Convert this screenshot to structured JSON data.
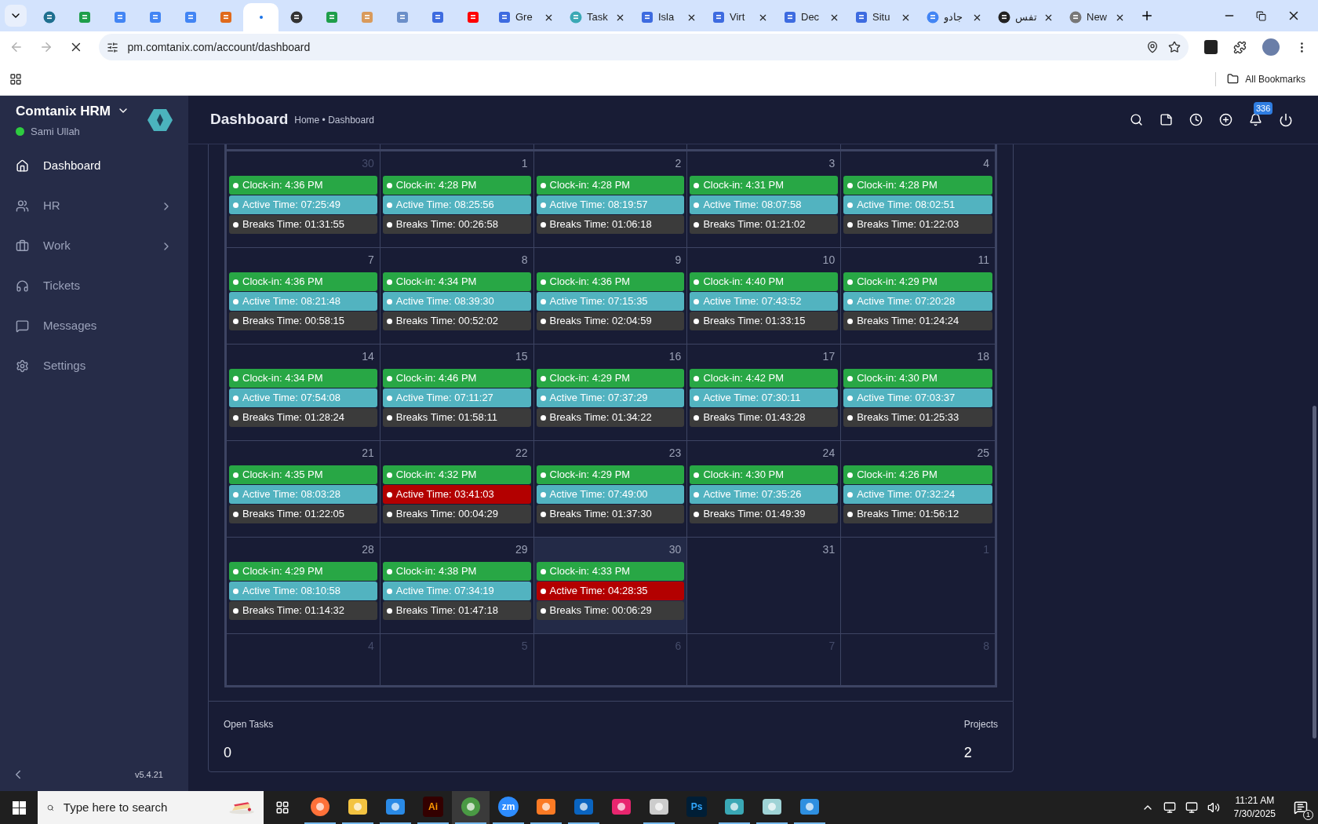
{
  "browser": {
    "tabs": [
      {
        "selected": false
      },
      {
        "selected": false
      },
      {
        "selected": false
      },
      {
        "selected": false
      },
      {
        "selected": false
      },
      {
        "selected": false
      },
      {
        "selected": true
      },
      {
        "selected": false
      },
      {
        "selected": false
      },
      {
        "selected": false
      },
      {
        "selected": false
      },
      {
        "selected": false
      },
      {
        "selected": false
      },
      {
        "title": "Gre",
        "selected": false
      },
      {
        "title": "Task",
        "selected": false
      },
      {
        "title": "Isla",
        "selected": false
      },
      {
        "title": "Virt",
        "selected": false
      },
      {
        "title": "Dec",
        "selected": false
      },
      {
        "title": "Situ",
        "selected": false
      },
      {
        "title": "جادو",
        "selected": false
      },
      {
        "title": "تفس",
        "selected": false
      },
      {
        "title": "New",
        "selected": false
      }
    ],
    "address": "pm.comtanix.com/account/dashboard",
    "bookmarks_label": "All Bookmarks"
  },
  "sidebar": {
    "brand": "Comtanix HRM",
    "user": "Sami Ullah",
    "online": true,
    "items": [
      {
        "label": "Dashboard",
        "selected": true,
        "has_submenu": false
      },
      {
        "label": "HR",
        "selected": false,
        "has_submenu": true
      },
      {
        "label": "Work",
        "selected": false,
        "has_submenu": true
      },
      {
        "label": "Tickets",
        "selected": false,
        "has_submenu": false
      },
      {
        "label": "Messages",
        "selected": false,
        "has_submenu": false
      },
      {
        "label": "Settings",
        "selected": false,
        "has_submenu": false
      }
    ],
    "version": "v5.4.21"
  },
  "header": {
    "title": "Dashboard",
    "breadcrumb": "Home • Dashboard",
    "notification_count": "336"
  },
  "calendar": {
    "weeks": [
      [
        {
          "day": "30",
          "muted": true,
          "today": false,
          "events": [
            {
              "text": "Clock-in: 4:36 PM",
              "color": "#28a745"
            },
            {
              "text": "Active Time: 07:25:49",
              "color": "#52b3c0"
            },
            {
              "text": "Breaks Time: 01:31:55",
              "color": "#3b3b3b"
            }
          ]
        },
        {
          "day": "1",
          "muted": false,
          "today": false,
          "events": [
            {
              "text": "Clock-in: 4:28 PM",
              "color": "#28a745"
            },
            {
              "text": "Active Time: 08:25:56",
              "color": "#52b3c0"
            },
            {
              "text": "Breaks Time: 00:26:58",
              "color": "#3b3b3b"
            }
          ]
        },
        {
          "day": "2",
          "muted": false,
          "today": false,
          "events": [
            {
              "text": "Clock-in: 4:28 PM",
              "color": "#28a745"
            },
            {
              "text": "Active Time: 08:19:57",
              "color": "#52b3c0"
            },
            {
              "text": "Breaks Time: 01:06:18",
              "color": "#3b3b3b"
            }
          ]
        },
        {
          "day": "3",
          "muted": false,
          "today": false,
          "events": [
            {
              "text": "Clock-in: 4:31 PM",
              "color": "#28a745"
            },
            {
              "text": "Active Time: 08:07:58",
              "color": "#52b3c0"
            },
            {
              "text": "Breaks Time: 01:21:02",
              "color": "#3b3b3b"
            }
          ]
        },
        {
          "day": "4",
          "muted": false,
          "today": false,
          "events": [
            {
              "text": "Clock-in: 4:28 PM",
              "color": "#28a745"
            },
            {
              "text": "Active Time: 08:02:51",
              "color": "#52b3c0"
            },
            {
              "text": "Breaks Time: 01:22:03",
              "color": "#3b3b3b"
            }
          ]
        }
      ],
      [
        {
          "day": "7",
          "muted": false,
          "today": false,
          "events": [
            {
              "text": "Clock-in: 4:36 PM",
              "color": "#28a745"
            },
            {
              "text": "Active Time: 08:21:48",
              "color": "#52b3c0"
            },
            {
              "text": "Breaks Time: 00:58:15",
              "color": "#3b3b3b"
            }
          ]
        },
        {
          "day": "8",
          "muted": false,
          "today": false,
          "events": [
            {
              "text": "Clock-in: 4:34 PM",
              "color": "#28a745"
            },
            {
              "text": "Active Time: 08:39:30",
              "color": "#52b3c0"
            },
            {
              "text": "Breaks Time: 00:52:02",
              "color": "#3b3b3b"
            }
          ]
        },
        {
          "day": "9",
          "muted": false,
          "today": false,
          "events": [
            {
              "text": "Clock-in: 4:36 PM",
              "color": "#28a745"
            },
            {
              "text": "Active Time: 07:15:35",
              "color": "#52b3c0"
            },
            {
              "text": "Breaks Time: 02:04:59",
              "color": "#3b3b3b"
            }
          ]
        },
        {
          "day": "10",
          "muted": false,
          "today": false,
          "events": [
            {
              "text": "Clock-in: 4:40 PM",
              "color": "#28a745"
            },
            {
              "text": "Active Time: 07:43:52",
              "color": "#52b3c0"
            },
            {
              "text": "Breaks Time: 01:33:15",
              "color": "#3b3b3b"
            }
          ]
        },
        {
          "day": "11",
          "muted": false,
          "today": false,
          "events": [
            {
              "text": "Clock-in: 4:29 PM",
              "color": "#28a745"
            },
            {
              "text": "Active Time: 07:20:28",
              "color": "#52b3c0"
            },
            {
              "text": "Breaks Time: 01:24:24",
              "color": "#3b3b3b"
            }
          ]
        }
      ],
      [
        {
          "day": "14",
          "muted": false,
          "today": false,
          "events": [
            {
              "text": "Clock-in: 4:34 PM",
              "color": "#28a745"
            },
            {
              "text": "Active Time: 07:54:08",
              "color": "#52b3c0"
            },
            {
              "text": "Breaks Time: 01:28:24",
              "color": "#3b3b3b"
            }
          ]
        },
        {
          "day": "15",
          "muted": false,
          "today": false,
          "events": [
            {
              "text": "Clock-in: 4:46 PM",
              "color": "#28a745"
            },
            {
              "text": "Active Time: 07:11:27",
              "color": "#52b3c0"
            },
            {
              "text": "Breaks Time: 01:58:11",
              "color": "#3b3b3b"
            }
          ]
        },
        {
          "day": "16",
          "muted": false,
          "today": false,
          "events": [
            {
              "text": "Clock-in: 4:29 PM",
              "color": "#28a745"
            },
            {
              "text": "Active Time: 07:37:29",
              "color": "#52b3c0"
            },
            {
              "text": "Breaks Time: 01:34:22",
              "color": "#3b3b3b"
            }
          ]
        },
        {
          "day": "17",
          "muted": false,
          "today": false,
          "events": [
            {
              "text": "Clock-in: 4:42 PM",
              "color": "#28a745"
            },
            {
              "text": "Active Time: 07:30:11",
              "color": "#52b3c0"
            },
            {
              "text": "Breaks Time: 01:43:28",
              "color": "#3b3b3b"
            }
          ]
        },
        {
          "day": "18",
          "muted": false,
          "today": false,
          "events": [
            {
              "text": "Clock-in: 4:30 PM",
              "color": "#28a745"
            },
            {
              "text": "Active Time: 07:03:37",
              "color": "#52b3c0"
            },
            {
              "text": "Breaks Time: 01:25:33",
              "color": "#3b3b3b"
            }
          ]
        }
      ],
      [
        {
          "day": "21",
          "muted": false,
          "today": false,
          "events": [
            {
              "text": "Clock-in: 4:35 PM",
              "color": "#28a745"
            },
            {
              "text": "Active Time: 08:03:28",
              "color": "#52b3c0"
            },
            {
              "text": "Breaks Time: 01:22:05",
              "color": "#3b3b3b"
            }
          ]
        },
        {
          "day": "22",
          "muted": false,
          "today": false,
          "events": [
            {
              "text": "Clock-in: 4:32 PM",
              "color": "#28a745"
            },
            {
              "text": "Active Time: 03:41:03",
              "color": "#b30000"
            },
            {
              "text": "Breaks Time: 00:04:29",
              "color": "#3b3b3b"
            }
          ]
        },
        {
          "day": "23",
          "muted": false,
          "today": false,
          "events": [
            {
              "text": "Clock-in: 4:29 PM",
              "color": "#28a745"
            },
            {
              "text": "Active Time: 07:49:00",
              "color": "#52b3c0"
            },
            {
              "text": "Breaks Time: 01:37:30",
              "color": "#3b3b3b"
            }
          ]
        },
        {
          "day": "24",
          "muted": false,
          "today": false,
          "events": [
            {
              "text": "Clock-in: 4:30 PM",
              "color": "#28a745"
            },
            {
              "text": "Active Time: 07:35:26",
              "color": "#52b3c0"
            },
            {
              "text": "Breaks Time: 01:49:39",
              "color": "#3b3b3b"
            }
          ]
        },
        {
          "day": "25",
          "muted": false,
          "today": false,
          "events": [
            {
              "text": "Clock-in: 4:26 PM",
              "color": "#28a745"
            },
            {
              "text": "Active Time: 07:32:24",
              "color": "#52b3c0"
            },
            {
              "text": "Breaks Time: 01:56:12",
              "color": "#3b3b3b"
            }
          ]
        }
      ],
      [
        {
          "day": "28",
          "muted": false,
          "today": false,
          "events": [
            {
              "text": "Clock-in: 4:29 PM",
              "color": "#28a745"
            },
            {
              "text": "Active Time: 08:10:58",
              "color": "#52b3c0"
            },
            {
              "text": "Breaks Time: 01:14:32",
              "color": "#3b3b3b"
            }
          ]
        },
        {
          "day": "29",
          "muted": false,
          "today": false,
          "events": [
            {
              "text": "Clock-in: 4:38 PM",
              "color": "#28a745"
            },
            {
              "text": "Active Time: 07:34:19",
              "color": "#52b3c0"
            },
            {
              "text": "Breaks Time: 01:47:18",
              "color": "#3b3b3b"
            }
          ]
        },
        {
          "day": "30",
          "muted": false,
          "today": true,
          "events": [
            {
              "text": "Clock-in: 4:33 PM",
              "color": "#28a745"
            },
            {
              "text": "Active Time: 04:28:35",
              "color": "#b30000"
            },
            {
              "text": "Breaks Time: 00:06:29",
              "color": "#3b3b3b"
            }
          ]
        },
        {
          "day": "31",
          "muted": false,
          "today": false
        },
        {
          "day": "1",
          "muted": true,
          "today": false
        }
      ],
      [
        {
          "day": "4",
          "muted": true,
          "today": false
        },
        {
          "day": "5",
          "muted": true,
          "today": false
        },
        {
          "day": "6",
          "muted": true,
          "today": false
        },
        {
          "day": "7",
          "muted": true,
          "today": false
        },
        {
          "day": "8",
          "muted": true,
          "today": false
        }
      ]
    ]
  },
  "stats": [
    {
      "label": "Open Tasks",
      "value": "0"
    },
    {
      "label": "Projects",
      "value": "2"
    }
  ],
  "taskbar": {
    "search_placeholder": "Type here to search",
    "apps": [
      {
        "running": true,
        "selected": false
      },
      {
        "running": true,
        "selected": false
      },
      {
        "running": true,
        "selected": false
      },
      {
        "label": "Ai",
        "running": true,
        "selected": false
      },
      {
        "running": true,
        "selected": true
      },
      {
        "label": "zm",
        "running": true,
        "selected": false
      },
      {
        "running": true,
        "selected": false
      },
      {
        "running": true,
        "selected": false
      },
      {
        "running": false,
        "selected": false
      },
      {
        "running": true,
        "selected": false
      },
      {
        "label": "Ps",
        "running": false,
        "selected": false
      },
      {
        "running": true,
        "selected": false
      },
      {
        "running": true,
        "selected": false
      },
      {
        "running": true,
        "selected": false
      }
    ],
    "time": "11:21 AM",
    "date": "7/30/2025",
    "notification_count": "1"
  }
}
